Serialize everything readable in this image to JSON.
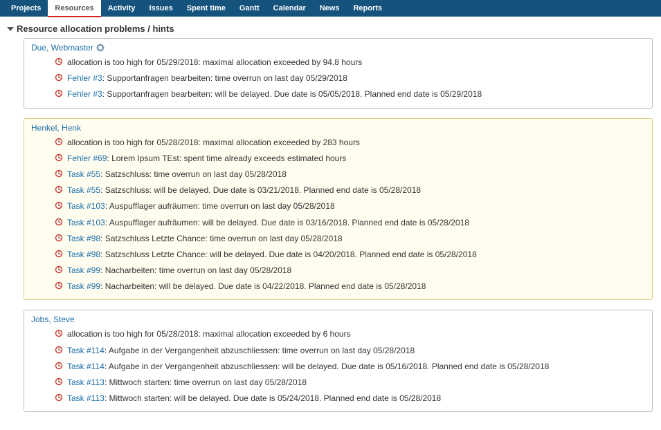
{
  "nav": {
    "items": [
      {
        "label": "Projects",
        "selected": false
      },
      {
        "label": "Resources",
        "selected": true
      },
      {
        "label": "Activity",
        "selected": false
      },
      {
        "label": "Issues",
        "selected": false
      },
      {
        "label": "Spent time",
        "selected": false
      },
      {
        "label": "Gantt",
        "selected": false
      },
      {
        "label": "Calendar",
        "selected": false
      },
      {
        "label": "News",
        "selected": false
      },
      {
        "label": "Reports",
        "selected": false
      }
    ]
  },
  "section": {
    "title": "Resource allocation problems / hints"
  },
  "resources": [
    {
      "name": "Due, Webmaster",
      "has_settings": true,
      "highlight": false,
      "entries": [
        {
          "link": null,
          "text": "allocation is too high for 05/29/2018: maximal allocation exceeded by 94.8 hours"
        },
        {
          "link": "Fehler #3",
          "text": "Supportanfragen bearbeiten: time overrun on last day 05/29/2018"
        },
        {
          "link": "Fehler #3",
          "text": "Supportanfragen bearbeiten: will be delayed. Due date is 05/05/2018. Planned end date is 05/29/2018"
        }
      ]
    },
    {
      "name": "Henkel, Henk",
      "has_settings": false,
      "highlight": true,
      "entries": [
        {
          "link": null,
          "text": "allocation is too high for 05/28/2018: maximal allocation exceeded by 283 hours"
        },
        {
          "link": "Fehler #69",
          "text": "Lorem Ipsum TEst: spent time already exceeds estimated hours"
        },
        {
          "link": "Task #55",
          "text": "Satzschluss: time overrun on last day 05/28/2018"
        },
        {
          "link": "Task #55",
          "text": "Satzschluss: will be delayed. Due date is 03/21/2018. Planned end date is 05/28/2018"
        },
        {
          "link": "Task #103",
          "text": "Auspufflager aufräumen: time overrun on last day 05/28/2018"
        },
        {
          "link": "Task #103",
          "text": "Auspufflager aufräumen: will be delayed. Due date is 03/16/2018. Planned end date is 05/28/2018"
        },
        {
          "link": "Task #98",
          "text": "Satzschluss Letzte Chance: time overrun on last day 05/28/2018"
        },
        {
          "link": "Task #98",
          "text": "Satzschluss Letzte Chance: will be delayed. Due date is 04/20/2018. Planned end date is 05/28/2018"
        },
        {
          "link": "Task #99",
          "text": "Nacharbeiten: time overrun on last day 05/28/2018"
        },
        {
          "link": "Task #99",
          "text": "Nacharbeiten: will be delayed. Due date is 04/22/2018. Planned end date is 05/28/2018"
        }
      ]
    },
    {
      "name": "Jobs, Steve",
      "has_settings": false,
      "highlight": false,
      "entries": [
        {
          "link": null,
          "text": "allocation is too high for 05/28/2018: maximal allocation exceeded by 6 hours"
        },
        {
          "link": "Task #114",
          "text": "Aufgabe in der Vergangenheit abzuschliessen: time overrun on last day 05/28/2018"
        },
        {
          "link": "Task #114",
          "text": "Aufgabe in der Vergangenheit abzuschliessen: will be delayed. Due date is 05/16/2018. Planned end date is 05/28/2018"
        },
        {
          "link": "Task #113",
          "text": "Mittwoch starten: time overrun on last day 05/28/2018"
        },
        {
          "link": "Task #113",
          "text": "Mittwoch starten: will be delayed. Due date is 05/24/2018. Planned end date is 05/28/2018"
        }
      ]
    }
  ],
  "icons": {
    "clock_color": "#c0392b",
    "gear_color": "#6a8fab"
  }
}
